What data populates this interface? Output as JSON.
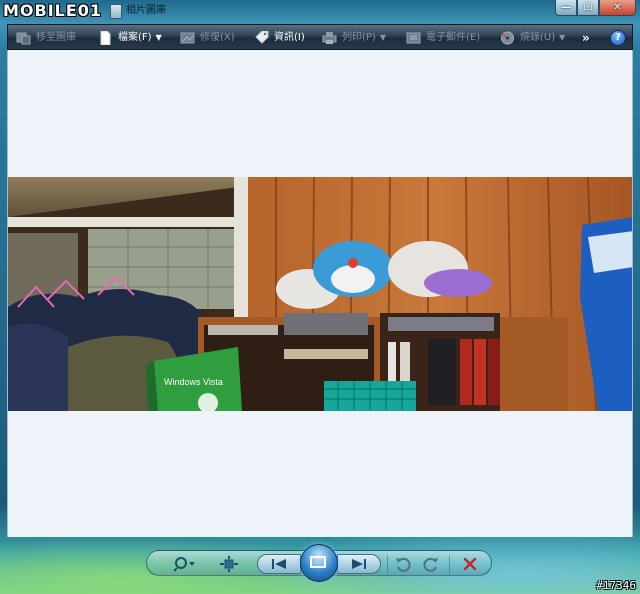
{
  "window": {
    "brand": "MOBILE01",
    "title": "相片圖庫",
    "controls": {
      "minimize": "—",
      "maximize": "☐",
      "close": "✕"
    }
  },
  "toolbar": {
    "items": [
      {
        "label": "移至圖庫",
        "enabled": false,
        "has_menu": false,
        "icon": "back-to-gallery-icon"
      },
      {
        "label": "檔案(F)",
        "enabled": true,
        "has_menu": true,
        "icon": "file-icon"
      },
      {
        "label": "修復(X)",
        "enabled": false,
        "has_menu": false,
        "icon": "fix-icon"
      },
      {
        "label": "資訊(I)",
        "enabled": true,
        "has_menu": false,
        "icon": "info-tag-icon"
      },
      {
        "label": "列印(P)",
        "enabled": false,
        "has_menu": true,
        "icon": "print-icon"
      },
      {
        "label": "電子郵件(E)",
        "enabled": false,
        "has_menu": false,
        "icon": "email-icon"
      },
      {
        "label": "燒錄(U)",
        "enabled": false,
        "has_menu": true,
        "icon": "burn-icon"
      }
    ],
    "overflow": "»",
    "help": "?"
  },
  "photo": {
    "box_label": "Windows Vista",
    "icon": "photo-image"
  },
  "playback": {
    "buttons": [
      "zoom-icon",
      "actual-size-icon",
      "previous-icon",
      "slideshow-icon",
      "next-icon",
      "rotate-ccw-icon",
      "rotate-cw-icon",
      "delete-icon"
    ]
  },
  "watermark": "#17346",
  "colors": {
    "toolbar_top": "#5a6f82",
    "toolbar_bottom": "#1c2d3c",
    "viewer_bg": "#eef3fa",
    "delete_red": "#c4282a"
  }
}
